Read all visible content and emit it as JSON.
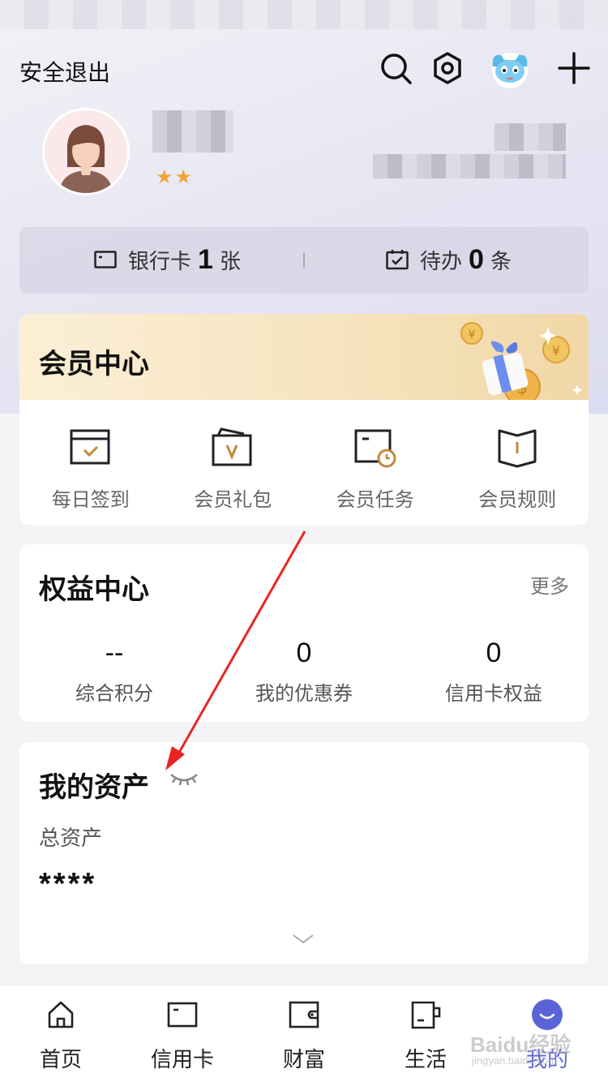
{
  "header": {
    "logout_label": "安全退出",
    "icons": [
      "search-icon",
      "settings-icon",
      "mascot-icon",
      "plus-icon"
    ]
  },
  "profile": {
    "stars": "★★"
  },
  "stats": {
    "bank_card_label": "银行卡",
    "bank_card_count": "1",
    "bank_card_unit": "张",
    "todo_label": "待办",
    "todo_count": "0",
    "todo_unit": "条"
  },
  "member_center": {
    "title": "会员中心",
    "items": [
      {
        "label": "每日签到",
        "icon": "checkin-icon"
      },
      {
        "label": "会员礼包",
        "icon": "gift-pack-icon"
      },
      {
        "label": "会员任务",
        "icon": "task-icon"
      },
      {
        "label": "会员规则",
        "icon": "rules-book-icon"
      }
    ]
  },
  "rights_center": {
    "title": "权益中心",
    "more_label": "更多",
    "items": [
      {
        "value": "--",
        "label": "综合积分"
      },
      {
        "value": "0",
        "label": "我的优惠券"
      },
      {
        "value": "0",
        "label": "信用卡权益"
      }
    ]
  },
  "assets": {
    "title": "我的资产",
    "total_label": "总资产",
    "total_value": "****"
  },
  "tabbar": {
    "items": [
      {
        "label": "首页",
        "icon": "home-icon"
      },
      {
        "label": "信用卡",
        "icon": "credit-card-icon"
      },
      {
        "label": "财富",
        "icon": "wallet-icon"
      },
      {
        "label": "生活",
        "icon": "cup-icon"
      },
      {
        "label": "我的",
        "icon": "profile-icon"
      }
    ],
    "active_index": 4
  },
  "watermark": {
    "main": "Baidu经验",
    "sub": "jingyan.baidu.com"
  },
  "colors": {
    "accent": "#5a64d8",
    "gold": "#c08a3a",
    "annotation_arrow": "#e8261f"
  }
}
